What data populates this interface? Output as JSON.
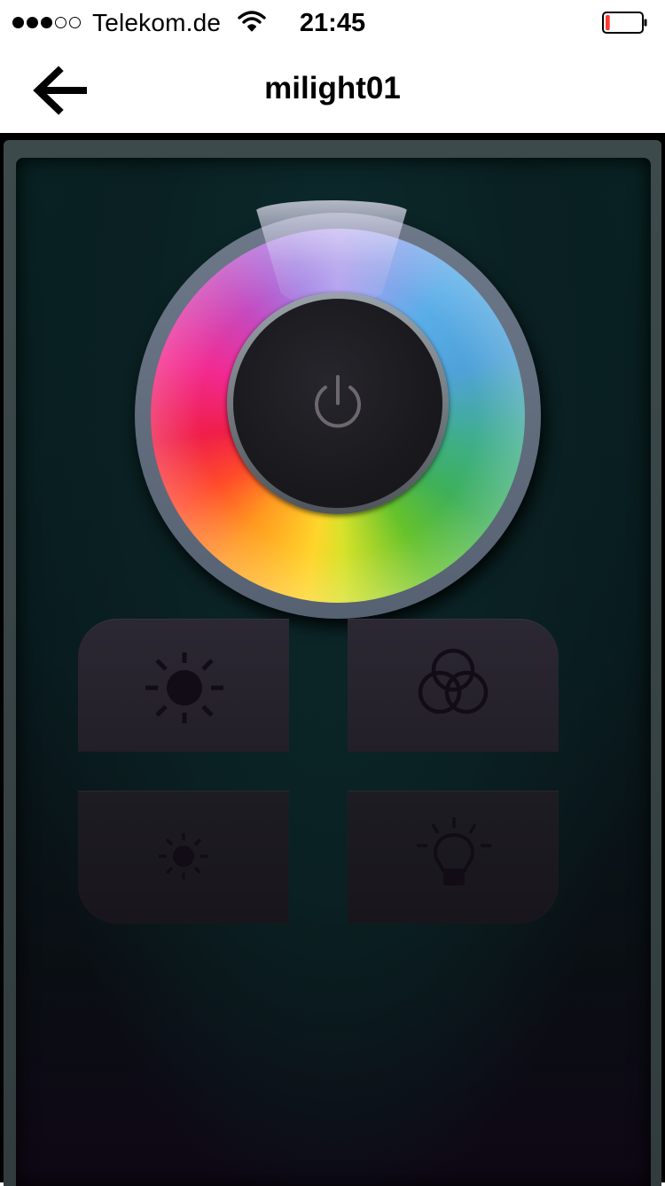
{
  "status_bar": {
    "signal_bars": 3,
    "signal_total": 5,
    "carrier": "Telekom.de",
    "wifi_icon": "wifi-icon",
    "time": "21:45",
    "battery_icon": "battery-low-icon",
    "battery_level": 0.12,
    "battery_color": "#ff3b30"
  },
  "nav": {
    "back_icon": "arrow-left-icon",
    "title": "milight01"
  },
  "remote": {
    "wheel_icon": "color-wheel",
    "power_icon": "power-icon",
    "buttons": [
      {
        "name": "brightness-up-button",
        "icon": "sun-large-icon"
      },
      {
        "name": "color-mode-button",
        "icon": "rgb-circles-icon"
      },
      {
        "name": "brightness-down-button",
        "icon": "sun-small-icon"
      },
      {
        "name": "white-mode-button",
        "icon": "light-bulb-icon"
      }
    ],
    "colors": {
      "screen": "#081f21",
      "rim": "#636e80",
      "button": "#29252f",
      "icon": "#120c16"
    }
  }
}
